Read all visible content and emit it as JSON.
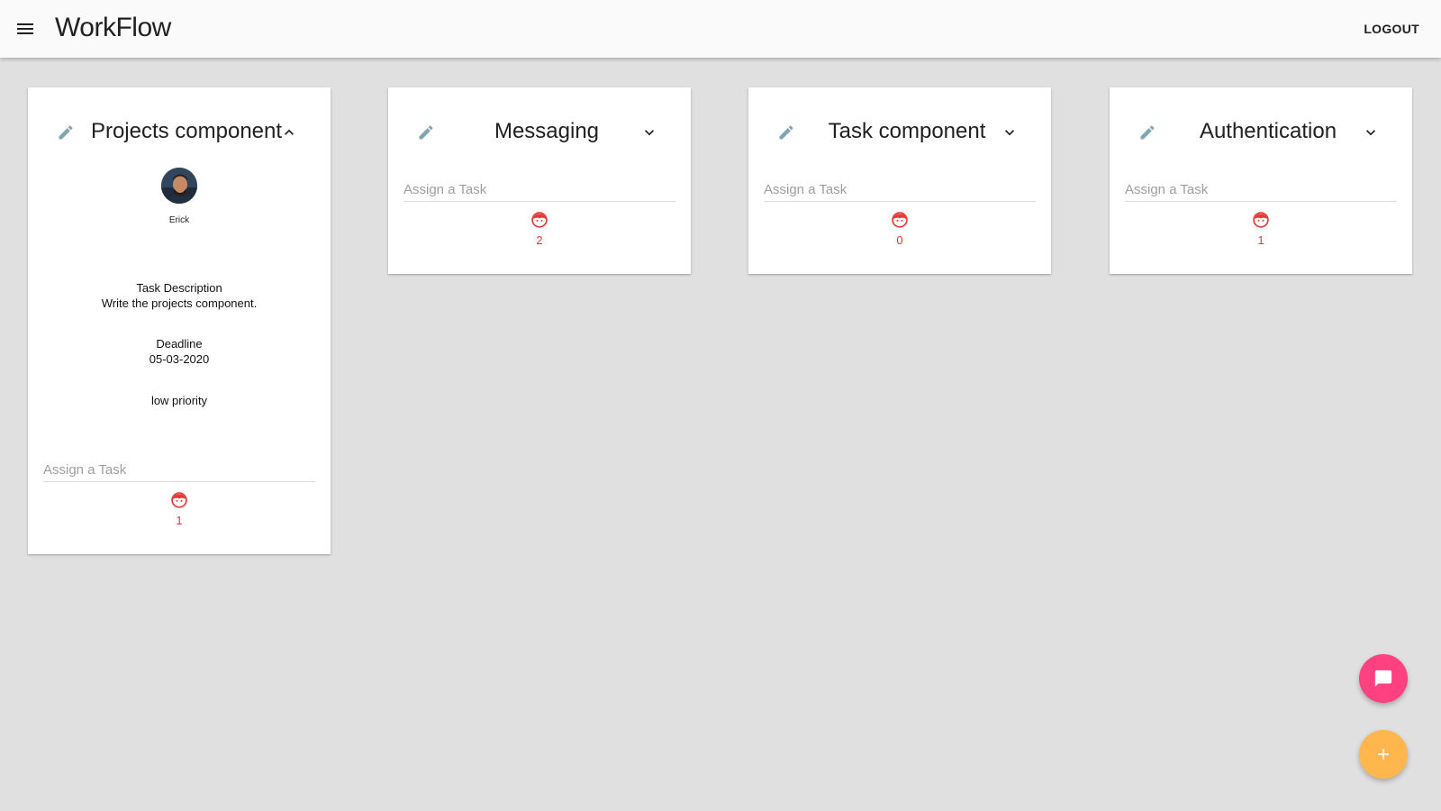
{
  "appbar": {
    "title": "WorkFlow",
    "logout_label": "LOGOUT"
  },
  "colors": {
    "accent_pink": "#ff4081",
    "accent_orange": "#ffb74d",
    "count_red": "#e53935",
    "edit_icon": "#7fa7b0"
  },
  "cards": [
    {
      "title": "Projects component",
      "expanded": true,
      "assignee": "Erick",
      "desc_label": "Task Description",
      "desc_text": "Write the projects component.",
      "deadline_label": "Deadline",
      "deadline": "05-03-2020",
      "priority": "low priority",
      "assign_placeholder": "Assign a Task",
      "count": "1"
    },
    {
      "title": "Messaging",
      "expanded": false,
      "assign_placeholder": "Assign a Task",
      "count": "2"
    },
    {
      "title": "Task component",
      "expanded": false,
      "assign_placeholder": "Assign a Task",
      "count": "0"
    },
    {
      "title": "Authentication",
      "expanded": false,
      "assign_placeholder": "Assign a Task",
      "count": "1"
    }
  ],
  "icons": {
    "menu": "menu-icon",
    "edit": "pencil-icon",
    "expand_less": "chevron-up-icon",
    "expand_more": "chevron-down-icon",
    "face": "face-icon",
    "chat": "chat-icon",
    "add": "plus-icon"
  }
}
